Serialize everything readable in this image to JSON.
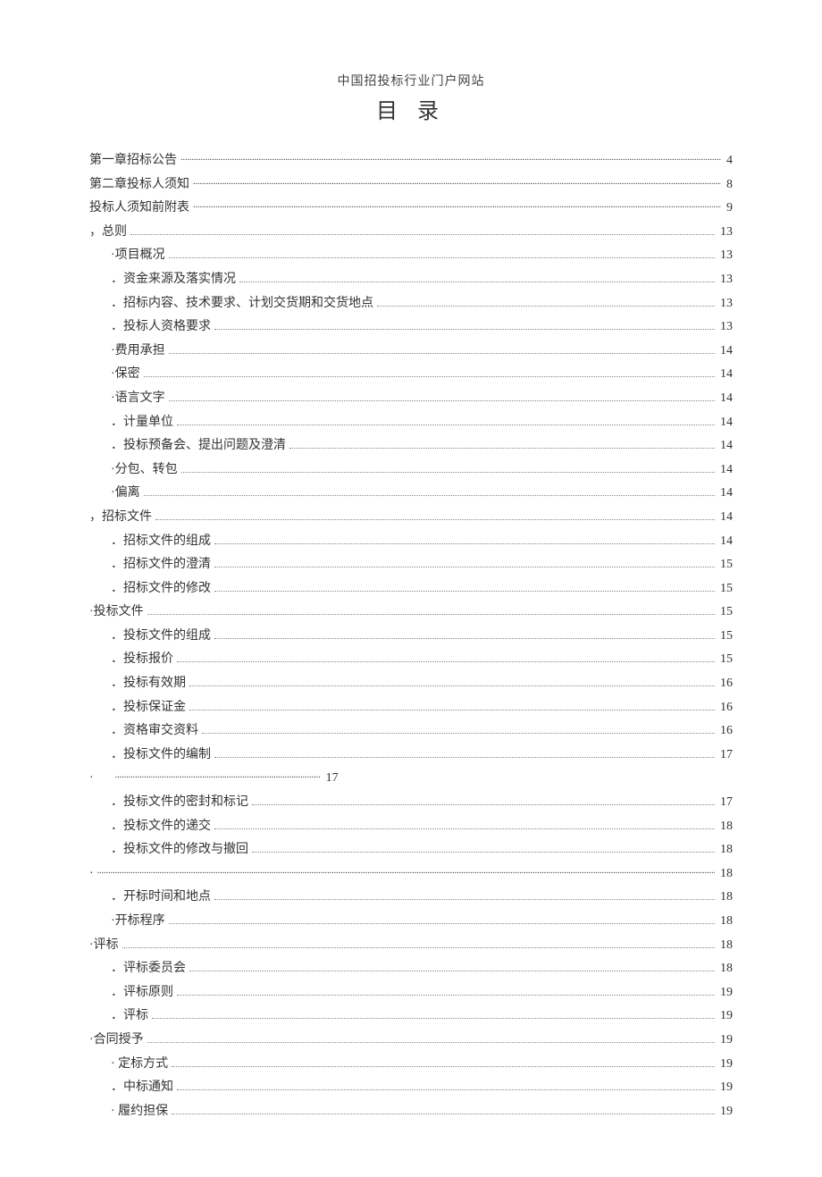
{
  "header": "中国招投标行业门户网站",
  "title": "目 录",
  "toc": [
    {
      "level": 0,
      "text": "第一章招标公告",
      "page": "4",
      "leader": "heavy"
    },
    {
      "level": 0,
      "text": "第二章投标人须知",
      "page": "8",
      "leader": "heavy"
    },
    {
      "level": 0,
      "text": "投标人须知前附表",
      "page": "9",
      "leader": "heavy"
    },
    {
      "level": 0,
      "text": "，总则",
      "page": "13",
      "leader": "dot"
    },
    {
      "level": 1,
      "text": "·项目概况",
      "page": "13",
      "leader": "dot"
    },
    {
      "level": 1,
      "text": "．资金来源及落实情况",
      "page": "13",
      "leader": "dot"
    },
    {
      "level": 1,
      "text": "．招标内容、技术要求、计划交货期和交货地点",
      "page": "13",
      "leader": "dot"
    },
    {
      "level": 1,
      "text": "．投标人资格要求",
      "page": "13",
      "leader": "dot"
    },
    {
      "level": 1,
      "text": "·费用承担",
      "page": "14",
      "leader": "dot"
    },
    {
      "level": 1,
      "text": "·保密",
      "page": "14",
      "leader": "dot"
    },
    {
      "level": 1,
      "text": "·语言文字",
      "page": "14",
      "leader": "dot"
    },
    {
      "level": 1,
      "text": "．计量单位",
      "page": "14",
      "leader": "dot"
    },
    {
      "level": 1,
      "text": "．投标预备会、提出问题及澄清",
      "page": "14",
      "leader": "dot"
    },
    {
      "level": 1,
      "text": "·分包、转包",
      "page": "14",
      "leader": "dot"
    },
    {
      "level": 1,
      "text": "·偏离",
      "page": "14",
      "leader": "dot"
    },
    {
      "level": 0,
      "text": "，招标文件",
      "page": "14",
      "leader": "dot"
    },
    {
      "level": 1,
      "text": "．招标文件的组成",
      "page": "14",
      "leader": "dot"
    },
    {
      "level": 1,
      "text": "．招标文件的澄清",
      "page": "15",
      "leader": "dot"
    },
    {
      "level": 1,
      "text": "．招标文件的修改",
      "page": "15",
      "leader": "dot"
    },
    {
      "level": 0,
      "text": "·投标文件",
      "page": "15",
      "leader": "dot"
    },
    {
      "level": 1,
      "text": "．投标文件的组成",
      "page": "15",
      "leader": "dot"
    },
    {
      "level": 1,
      "text": "．投标报价",
      "page": "15",
      "leader": "dot"
    },
    {
      "level": 1,
      "text": "．投标有效期",
      "page": "16",
      "leader": "dot"
    },
    {
      "level": 1,
      "text": "．投标保证金",
      "page": "16",
      "leader": "dot"
    },
    {
      "level": 1,
      "text": "．资格审交资料",
      "page": "16",
      "leader": "dot"
    },
    {
      "level": 1,
      "text": "．投标文件的编制",
      "page": "17",
      "leader": "dot"
    },
    {
      "level": 0,
      "text": "·",
      "page": "17",
      "leader": "short"
    },
    {
      "level": 1,
      "text": "．投标文件的密封和标记",
      "page": "17",
      "leader": "dot"
    },
    {
      "level": 1,
      "text": "．投标文件的递交",
      "page": "18",
      "leader": "dot"
    },
    {
      "level": 1,
      "text": "．投标文件的修改与撤回",
      "page": "18",
      "leader": "dot"
    },
    {
      "level": 0,
      "text": "·",
      "page": "18",
      "leader": "heavy"
    },
    {
      "level": 1,
      "text": "．开标时间和地点",
      "page": "18",
      "leader": "dot"
    },
    {
      "level": 1,
      "text": "·开标程序",
      "page": "18",
      "leader": "dot"
    },
    {
      "level": 0,
      "text": "·评标",
      "page": "18",
      "leader": "dot"
    },
    {
      "level": 1,
      "text": "．评标委员会",
      "page": "18",
      "leader": "dot"
    },
    {
      "level": 1,
      "text": "．评标原则",
      "page": "19",
      "leader": "dot"
    },
    {
      "level": 1,
      "text": "．评标",
      "page": "19",
      "leader": "dot"
    },
    {
      "level": 0,
      "text": "·合同授予",
      "page": "19",
      "leader": "dot"
    },
    {
      "level": 1,
      "text": "· 定标方式",
      "page": "19",
      "leader": "dot"
    },
    {
      "level": 1,
      "text": "．中标通知",
      "page": "19",
      "leader": "dot"
    },
    {
      "level": 1,
      "text": "· 履约担保",
      "page": "19",
      "leader": "dot"
    }
  ]
}
